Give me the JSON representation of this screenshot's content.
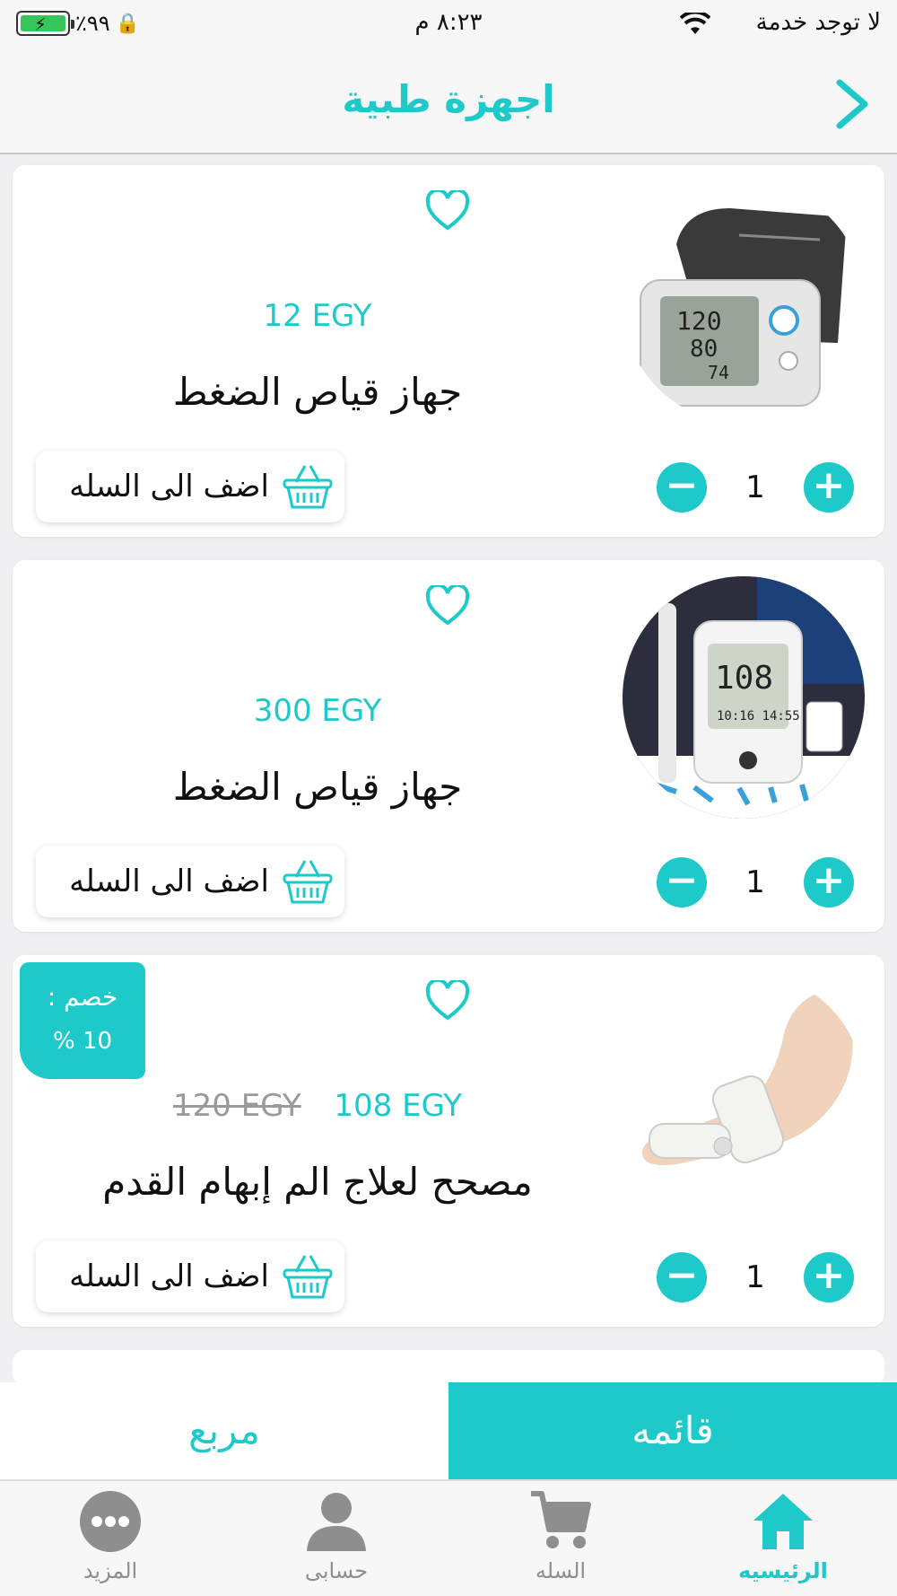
{
  "status_bar": {
    "carrier": "لا توجد خدمة",
    "time": "٨:٢٣ م",
    "battery": "٪٩٩"
  },
  "nav": {
    "title": "اجهزة طبية"
  },
  "products": [
    {
      "price": "12 EGY",
      "name": "جهاز قياص الضغط",
      "qty": "1",
      "add_label": "اضف الى السله"
    },
    {
      "price": "300 EGY",
      "name": "جهاز قياص الضغط",
      "qty": "1",
      "add_label": "اضف الى السله"
    },
    {
      "price": "108 EGY",
      "old_price": "120 EGY",
      "name": "مصحح لعلاج الم إبهام القدم",
      "qty": "1",
      "add_label": "اضف الى السله",
      "discount_label": "خصم :",
      "discount_value": "% 10"
    }
  ],
  "view_toggle": {
    "list": "قائمه",
    "grid": "مربع"
  },
  "tabs": [
    {
      "label": "الرئيسيه",
      "icon": "home-icon",
      "active": true
    },
    {
      "label": "السله",
      "icon": "cart-icon"
    },
    {
      "label": "حسابى",
      "icon": "user-icon"
    },
    {
      "label": "المزيد",
      "icon": "more-icon"
    }
  ],
  "colors": {
    "accent": "#1ec9c9",
    "inactive": "#8e8e8e"
  }
}
